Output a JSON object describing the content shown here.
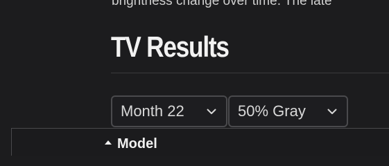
{
  "article": {
    "intro_text": "brightness change over time. The late",
    "section_title": "TV Results"
  },
  "filters": {
    "month": {
      "selected": "Month 22"
    },
    "gray": {
      "selected": "50% Gray"
    }
  },
  "results_panel": {
    "title": "Model"
  },
  "colors": {
    "background": "#1c1c1e",
    "border": "#4a4a4d",
    "text": "#e6e6e6"
  }
}
